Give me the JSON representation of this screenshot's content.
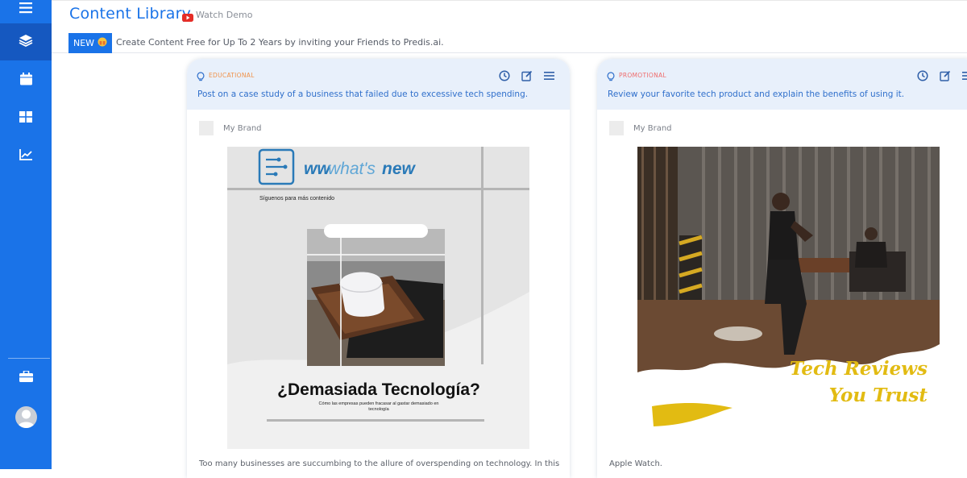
{
  "header": {
    "title": "Content Library",
    "watch_demo": "Watch Demo",
    "new_badge": "NEW",
    "promo": "Create Content Free for Up To 2 Years by inviting your Friends to Predis.ai."
  },
  "colors": {
    "primary": "#1a73e8",
    "educational": "#f0924a",
    "promotional": "#ef6c6c",
    "card_header_bg": "#e8f0fb"
  },
  "sidebar": {
    "items": [
      {
        "icon": "hamburger-menu-icon"
      },
      {
        "icon": "layers-icon",
        "active": true
      },
      {
        "icon": "calendar-icon"
      },
      {
        "icon": "grid-icon"
      },
      {
        "icon": "chart-icon"
      },
      {
        "icon": "briefcase-icon"
      },
      {
        "icon": "avatar"
      }
    ]
  },
  "cards": [
    {
      "category": "EDUCATIONAL",
      "description": "Post on a case study of a business that failed due to excessive tech spending.",
      "brand": "My Brand",
      "image": {
        "logo_text_a": "ww",
        "logo_text_b": "what's",
        "logo_text_c": "new",
        "follow": "Síguenos para más contenido",
        "headline": "¿Demasiada Tecnología?",
        "subline_1": "Cómo las empresas pueden fracasar al gastar demasiado en",
        "subline_2": "tecnología"
      },
      "caption": "Too many businesses are succumbing to the allure of overspending on technology. In this"
    },
    {
      "category": "PROMOTIONAL",
      "description": "Review your favorite tech product and explain the benefits of using it.",
      "brand": "My Brand",
      "image": {
        "headline_1": "Tech Reviews",
        "headline_2": "You Trust"
      },
      "caption": "Apple Watch."
    }
  ]
}
